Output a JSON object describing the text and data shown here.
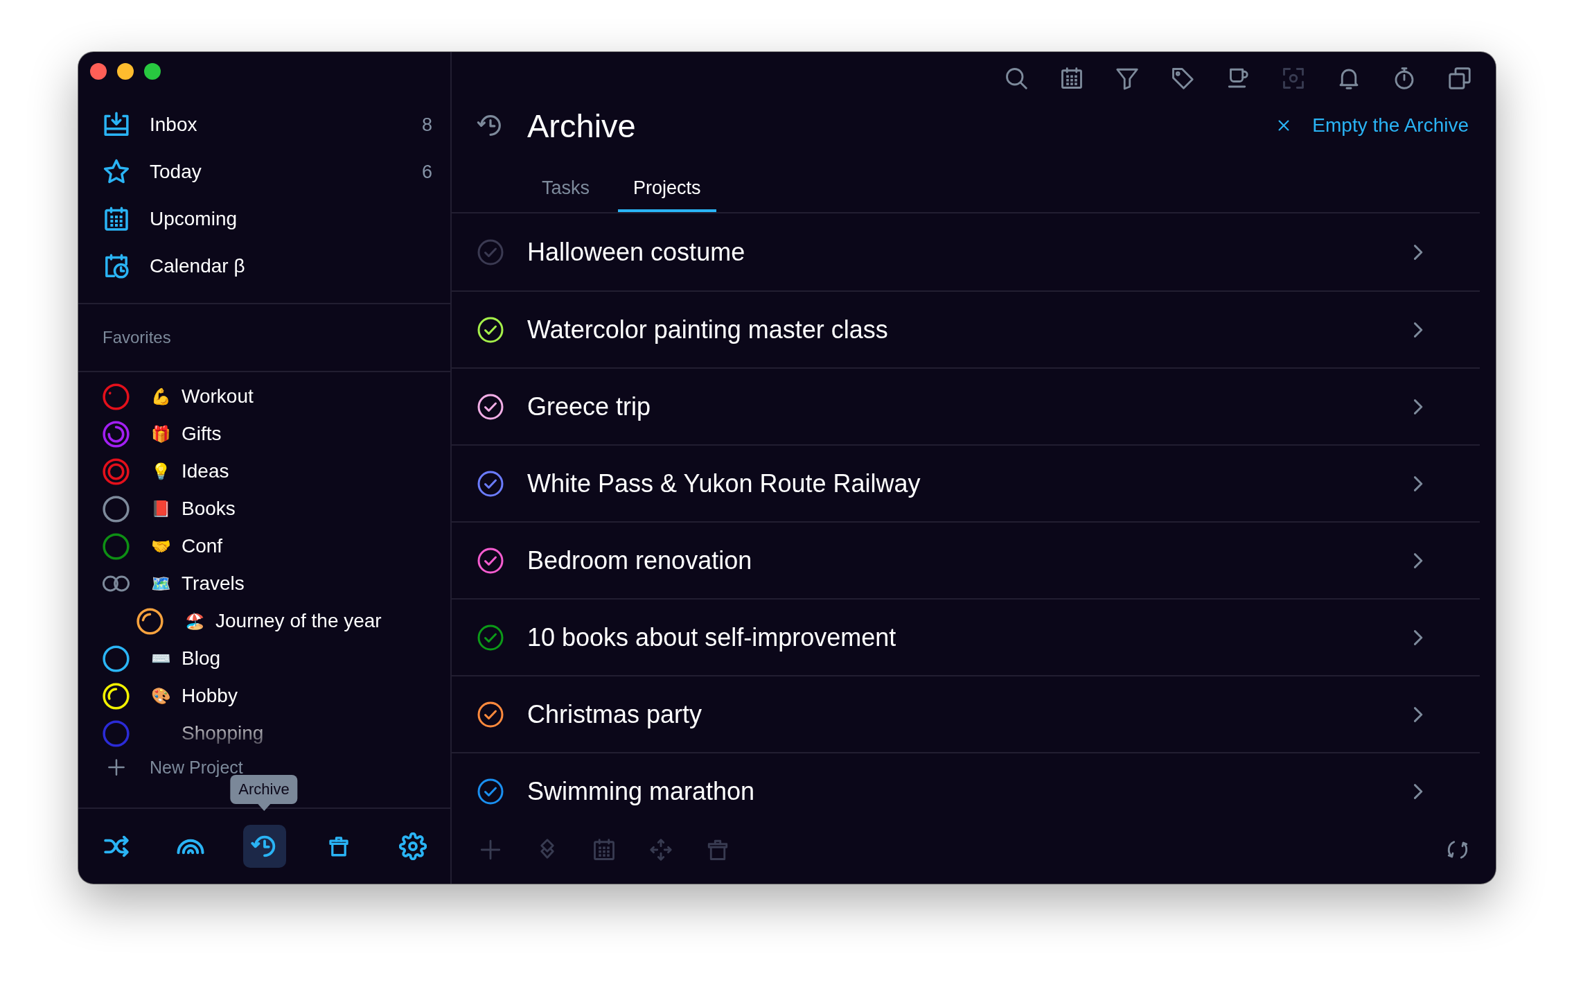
{
  "sidebar": {
    "nav": [
      {
        "kind": "inbox",
        "label": "Inbox",
        "count": "8"
      },
      {
        "kind": "today",
        "label": "Today",
        "count": "6"
      },
      {
        "kind": "upcoming",
        "label": "Upcoming"
      },
      {
        "kind": "calendar",
        "label": "Calendar β"
      }
    ],
    "favorites_heading": "Favorites",
    "projects": [
      {
        "kind": "dot",
        "color": "#e3101b",
        "emoji": "💪",
        "name": "Workout"
      },
      {
        "kind": "most",
        "color": "#a21ff2",
        "emoji": "🎁",
        "name": "Gifts"
      },
      {
        "kind": "full",
        "color": "#e3101b",
        "emoji": "💡",
        "name": "Ideas"
      },
      {
        "kind": "empty",
        "color": "#7d8a9b",
        "emoji": "📕",
        "name": "Books"
      },
      {
        "kind": "empty",
        "color": "#0e8f14",
        "emoji": "🤝",
        "name": "Conf"
      },
      {
        "kind": "folder",
        "color": "#7d8a9b",
        "emoji": "🗺️",
        "name": "Travels",
        "children": [
          {
            "kind": "quarter",
            "color": "#f7a23e",
            "emoji": "🏖️",
            "name": "Journey of the year"
          }
        ]
      },
      {
        "kind": "empty",
        "color": "#2bb5f5",
        "emoji": "⌨️",
        "name": "Blog"
      },
      {
        "kind": "third",
        "color": "#f2f200",
        "emoji": "🎨",
        "name": "Hobby"
      },
      {
        "kind": "empty",
        "color": "#2b2bd6",
        "name": "Shopping"
      }
    ],
    "new_project": "New Project",
    "toolbar": [
      {
        "kind": "shuffle",
        "selected": false
      },
      {
        "kind": "rainbow",
        "selected": false
      },
      {
        "kind": "archive",
        "selected": true
      },
      {
        "kind": "trash",
        "selected": false
      },
      {
        "kind": "settings",
        "selected": false
      }
    ],
    "tooltip": "Archive"
  },
  "main": {
    "toolbar": [
      {
        "kind": "search",
        "disabled": false
      },
      {
        "kind": "calendar",
        "disabled": false
      },
      {
        "kind": "filter",
        "disabled": false
      },
      {
        "kind": "tag",
        "disabled": false
      },
      {
        "kind": "cup",
        "disabled": false
      },
      {
        "kind": "focus",
        "disabled": true
      },
      {
        "kind": "bell",
        "disabled": false
      },
      {
        "kind": "stopwatch",
        "disabled": false
      },
      {
        "kind": "copy",
        "disabled": false
      }
    ],
    "title": "Archive",
    "action": "Empty the Archive",
    "tabs": [
      {
        "label": "Tasks",
        "selected": false
      },
      {
        "label": "Projects",
        "selected": true
      }
    ],
    "rows": [
      {
        "title": "Halloween costume",
        "color": "#3b3a52"
      },
      {
        "title": "Watercolor painting master class",
        "color": "#a5f04a"
      },
      {
        "title": "Greece trip",
        "color": "#f2aee6"
      },
      {
        "title": "White Pass & Yukon Route Railway",
        "color": "#6b7cff"
      },
      {
        "title": "Bedroom renovation",
        "color": "#f55ccf"
      },
      {
        "title": "10 books about self-improvement",
        "color": "#0c9a18"
      },
      {
        "title": "Christmas party",
        "color": "#ff8a3d"
      },
      {
        "title": "Swimming marathon",
        "color": "#1a8ff0"
      }
    ],
    "bottom_toolbar": [
      {
        "kind": "add",
        "disabled": true
      },
      {
        "kind": "layers",
        "disabled": true
      },
      {
        "kind": "calendar",
        "disabled": true
      },
      {
        "kind": "move",
        "disabled": true
      },
      {
        "kind": "trash",
        "disabled": true
      },
      {
        "kind": "refresh",
        "disabled": false
      }
    ]
  }
}
